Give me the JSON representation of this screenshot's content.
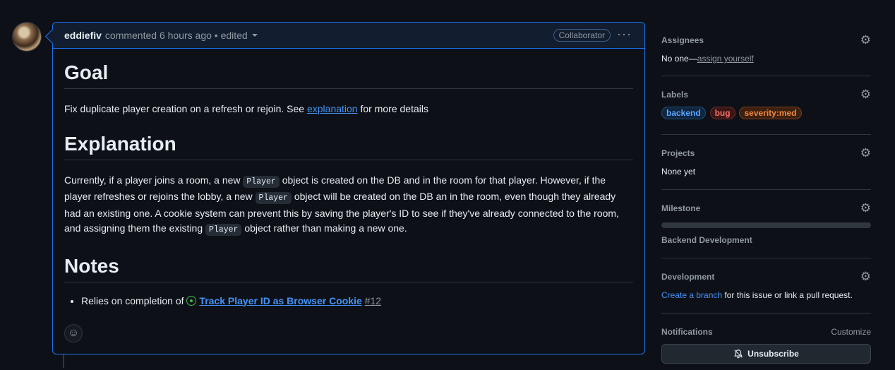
{
  "comment": {
    "author": "eddiefiv",
    "meta": "commented 6 hours ago • edited",
    "badge": "Collaborator",
    "more_label": "···"
  },
  "content": {
    "goal_heading": "Goal",
    "goal_text_before": "Fix duplicate player creation on a refresh or rejoin. See ",
    "goal_link": "explanation",
    "goal_text_after": " for more details",
    "explanation_heading": "Explanation",
    "expl_1": "Currently, if a player joins a room, a new ",
    "code": "Player",
    "expl_2": " object is created on the DB and in the room for that player. However, if the player refreshes or rejoins the lobby, a new ",
    "expl_3": " object will be created on the DB an in the room, even though they already had an existing one. A cookie system can prevent this by saving the player's ID to see if they've already connected to the room, and assigning them the existing ",
    "expl_4": " object rather than making a new one.",
    "notes_heading": "Notes",
    "note_prefix": "Relies on completion of ",
    "note_issue_title": "Track Player ID as Browser Cookie",
    "note_issue_number": "#12"
  },
  "sidebar": {
    "assignees_title": "Assignees",
    "assignees_none": "No one—",
    "assign_yourself": "assign yourself",
    "labels_title": "Labels",
    "labels": [
      {
        "name": "backend",
        "color": "#58a6ff"
      },
      {
        "name": "bug",
        "color": "#f47067"
      },
      {
        "name": "severity:med",
        "color": "#f0883e"
      }
    ],
    "projects_title": "Projects",
    "projects_value": "None yet",
    "milestone_title": "Milestone",
    "milestone_progress": 0,
    "milestone_name": "Backend Development",
    "development_title": "Development",
    "dev_link": "Create a branch",
    "dev_text": " for this issue or link a pull request.",
    "notifications_title": "Notifications",
    "customize": "Customize",
    "unsubscribe": "Unsubscribe"
  }
}
